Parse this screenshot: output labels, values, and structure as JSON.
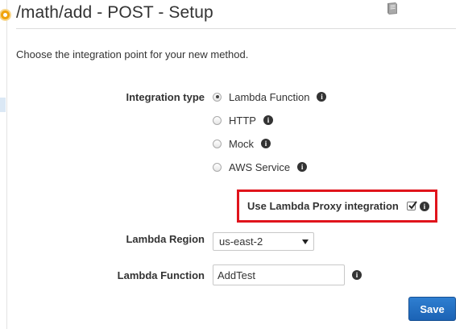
{
  "header": {
    "title": "/math/add - POST - Setup"
  },
  "intro": "Choose the integration point for your new method.",
  "integration": {
    "label": "Integration type",
    "options": [
      {
        "label": "Lambda Function",
        "selected": true
      },
      {
        "label": "HTTP",
        "selected": false
      },
      {
        "label": "Mock",
        "selected": false
      },
      {
        "label": "AWS Service",
        "selected": false
      }
    ]
  },
  "proxy": {
    "label": "Use Lambda Proxy integration",
    "checked": true
  },
  "region": {
    "label": "Lambda Region",
    "value": "us-east-2"
  },
  "function": {
    "label": "Lambda Function",
    "value": "AddTest"
  },
  "actions": {
    "save_label": "Save"
  },
  "colors": {
    "accent": "#1b63b5",
    "highlight_border": "#e0141c",
    "step_dot": "#f0a30a"
  },
  "icons": {
    "info": "i"
  }
}
